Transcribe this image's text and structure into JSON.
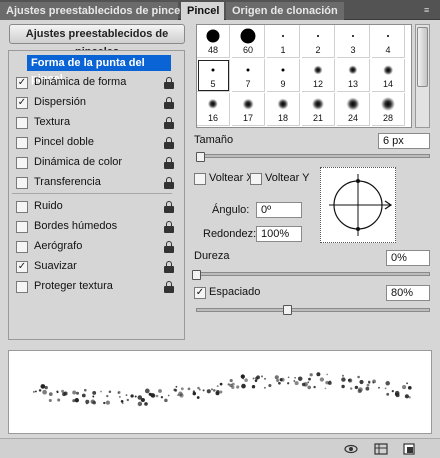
{
  "tabs": [
    {
      "label": "Ajustes preestablecidos de pinceles"
    },
    {
      "label": "Pincel"
    },
    {
      "label": "Origen de clonación"
    }
  ],
  "presets_button": "Ajustes preestablecidos de pinceles",
  "options": {
    "header": "Forma de la punta del pincel",
    "items": [
      {
        "label": "Dinámica de forma",
        "checked": true,
        "locked": true
      },
      {
        "label": "Dispersión",
        "checked": true,
        "locked": true
      },
      {
        "label": "Textura",
        "checked": false,
        "locked": true
      },
      {
        "label": "Pincel doble",
        "checked": false,
        "locked": true
      },
      {
        "label": "Dinámica de color",
        "checked": false,
        "locked": true
      },
      {
        "label": "Transferencia",
        "checked": false,
        "locked": true
      },
      {
        "label": "Ruido",
        "checked": false,
        "locked": true
      },
      {
        "label": "Bordes húmedos",
        "checked": false,
        "locked": true
      },
      {
        "label": "Aerógrafo",
        "checked": false,
        "locked": true
      },
      {
        "label": "Suavizar",
        "checked": true,
        "locked": true
      },
      {
        "label": "Proteger textura",
        "checked": false,
        "locked": true
      }
    ]
  },
  "brushes": {
    "rows": [
      [
        "48",
        "60",
        "1",
        "2",
        "3",
        "4"
      ],
      [
        "5",
        "7",
        "9",
        "12",
        "13",
        "14"
      ],
      [
        "16",
        "17",
        "18",
        "21",
        "24",
        "28"
      ]
    ],
    "selected": "5"
  },
  "controls": {
    "size_label": "Tamaño",
    "size_value": "6 px",
    "flip_x_label": "Voltear X",
    "flip_y_label": "Voltear Y",
    "angle_label": "Ángulo:",
    "angle_value": "0º",
    "roundness_label": "Redondez:",
    "roundness_value": "100%",
    "hardness_label": "Dureza",
    "hardness_value": "0%",
    "spacing_label": "Espaciado",
    "spacing_value": "80%",
    "spacing_checked": true
  },
  "colors": {
    "tab_bg": "#535353",
    "selection": "#0a64d6",
    "panel": "#d6d6d6"
  }
}
